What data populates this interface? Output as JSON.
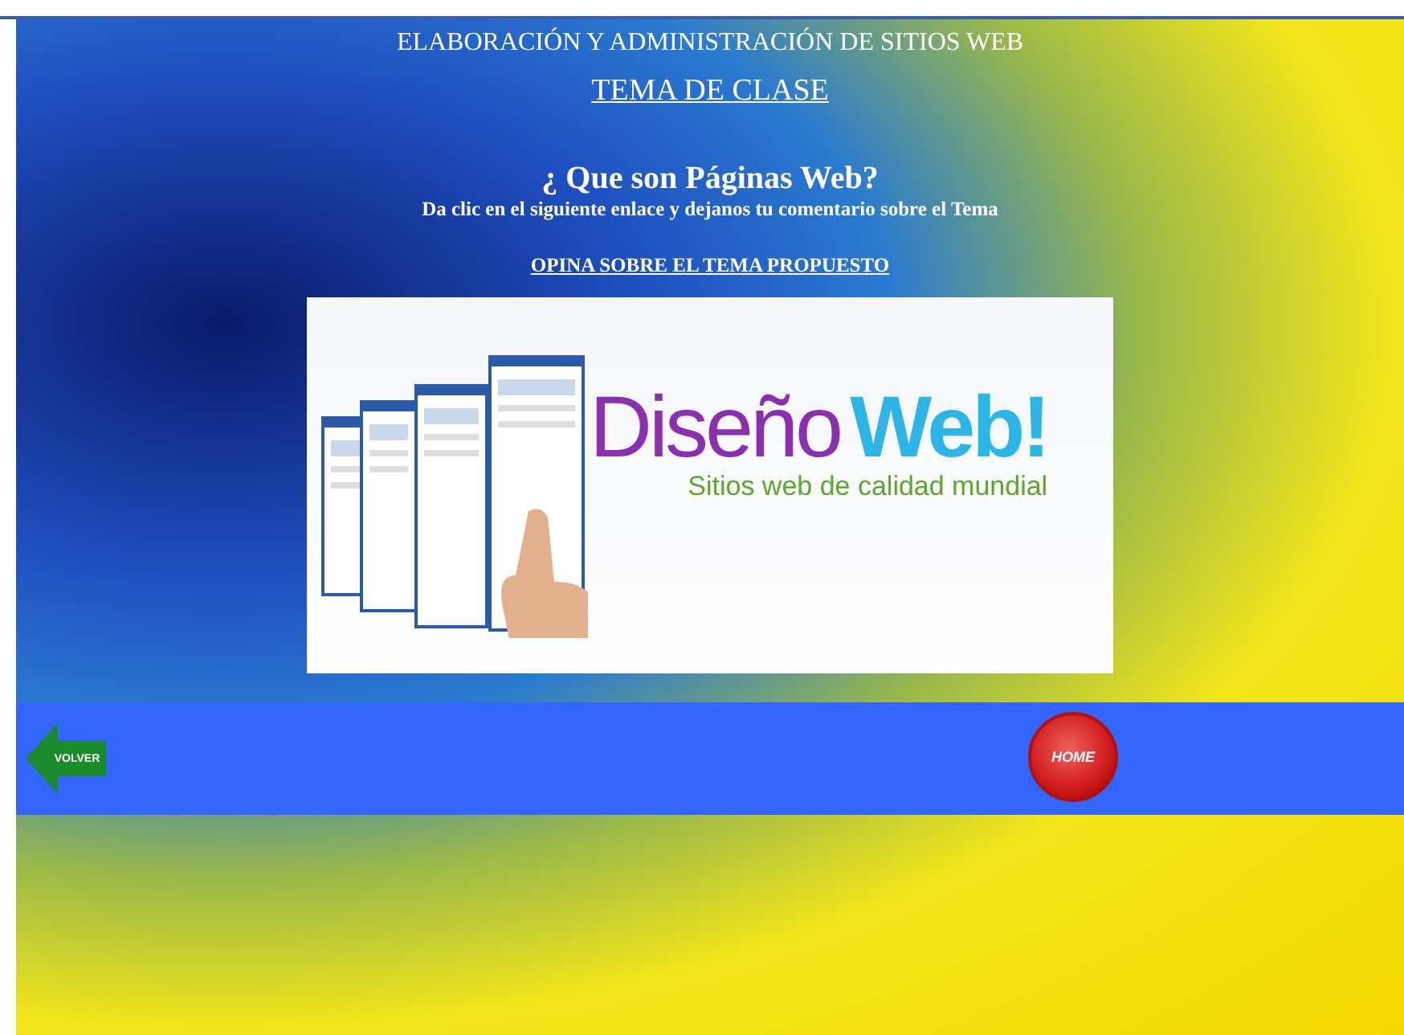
{
  "header": {
    "course_title": "ELABORACIÓN Y ADMINISTRACIÓN  DE SITIOS WEB",
    "section_link": "TEMA DE CLASE"
  },
  "topic": {
    "question": "¿ Que son Páginas Web?",
    "instruction": "Da clic en el siguiente enlace y dejanos tu comentario sobre el Tema",
    "link": "OPINA SOBRE EL TEMA PROPUESTO"
  },
  "banner": {
    "headline_1": "Diseño",
    "headline_2": "Web!",
    "tagline": "Sitios web de calidad mundial"
  },
  "nav_bar": {
    "back_button": "VOLVER",
    "home_button": "HOME"
  }
}
